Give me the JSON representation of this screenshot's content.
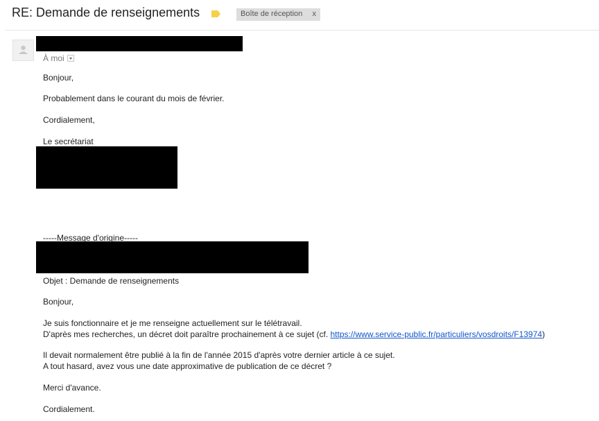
{
  "header": {
    "subject": "RE: Demande de renseignements",
    "label_chip": "Boîte de réception",
    "label_remove": "x",
    "label_color": "#f7d04a"
  },
  "sender": {
    "recipient_text": "À moi"
  },
  "reply": {
    "greeting": "Bonjour,",
    "body": "Probablement dans le courant du mois de février.",
    "closing": "Cordialement,",
    "signature": "Le secrétariat"
  },
  "original": {
    "separator": "-----Message d'origine-----",
    "objet": "Objet : Demande de renseignements",
    "greeting": "Bonjour,",
    "p1_line1": "Je suis fonctionnaire et je me renseigne actuellement sur le télétravail.",
    "p1_line2_prefix": "D'après mes recherches, un décret doit paraître prochainement à ce sujet (cf. ",
    "p1_link": "https://www.service-public.fr/particuliers/vosdroits/F13974",
    "p1_line2_suffix": ")",
    "p2_line1": "Il devait normalement être publié à la fin de l'année 2015 d'après votre dernier article à ce sujet.",
    "p2_line2": "A tout hasard, avez vous une date approximative de publication de ce décret ?",
    "thanks": "Merci d'avance.",
    "closing": "Cordialement."
  }
}
